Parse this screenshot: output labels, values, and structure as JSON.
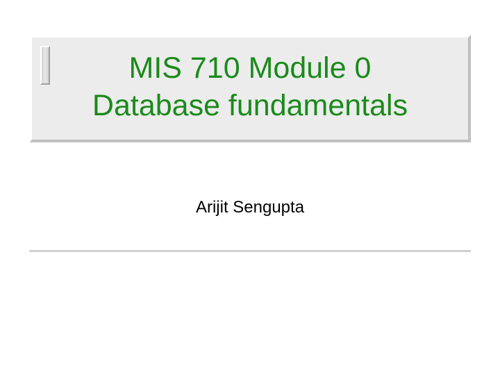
{
  "slide": {
    "title_line1": "MIS 710 Module 0",
    "title_line2": "Database fundamentals",
    "author": "Arijit Sengupta"
  }
}
